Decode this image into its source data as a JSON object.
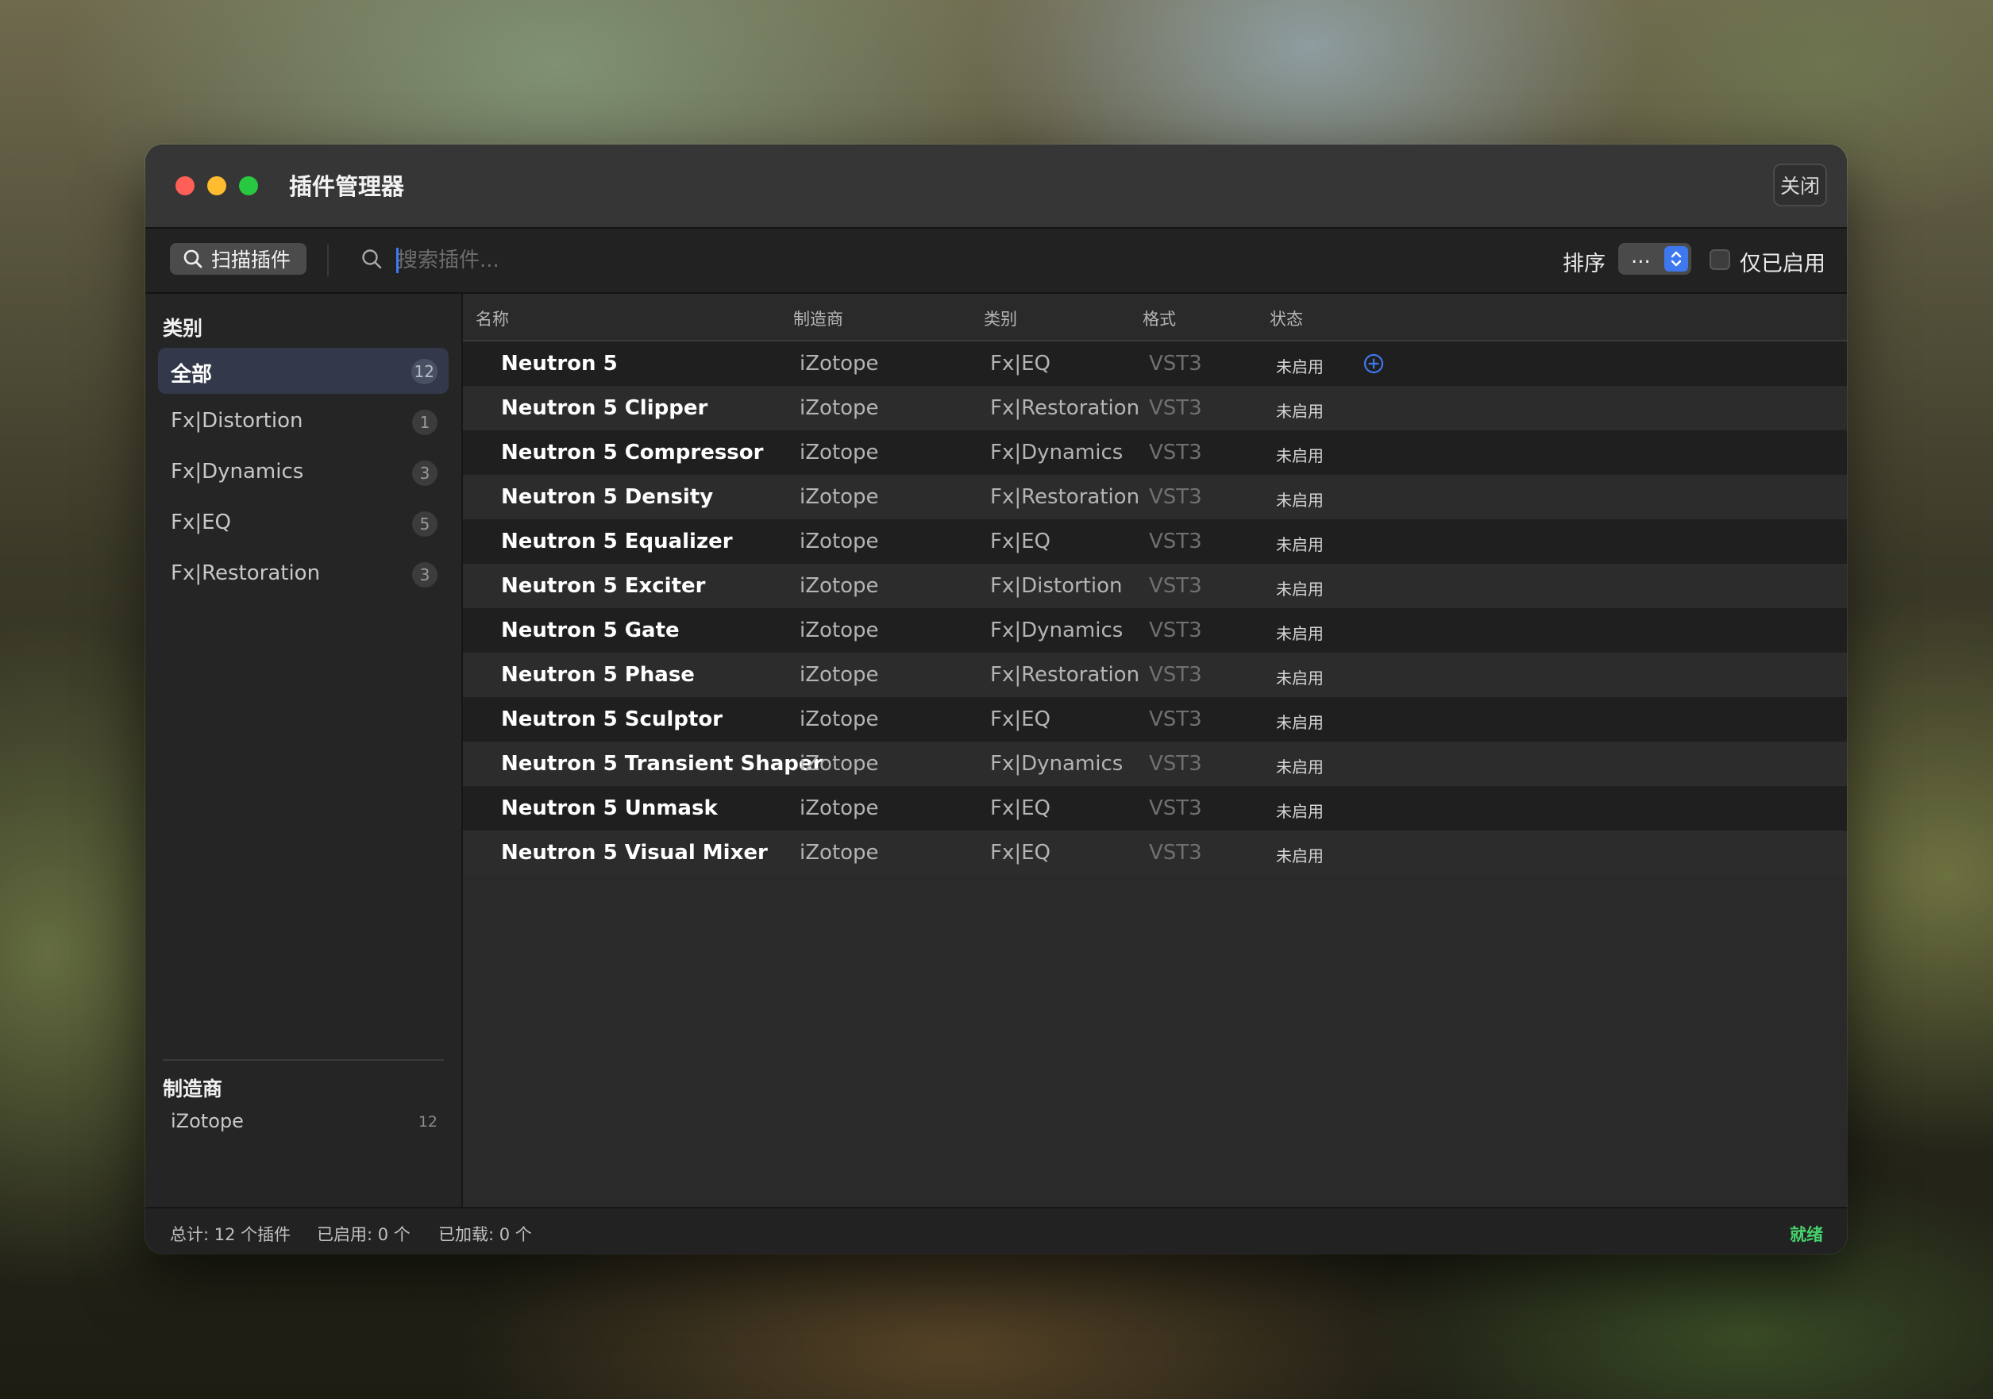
{
  "window": {
    "title": "插件管理器",
    "close_label": "关闭"
  },
  "toolbar": {
    "scan_label": "扫描插件",
    "search_placeholder": "搜索插件...",
    "sort_label": "排序",
    "sort_value": "...",
    "enabled_only_label": "仅已启用",
    "enabled_only_checked": false
  },
  "sidebar": {
    "categories_title": "类别",
    "categories": [
      {
        "label": "全部",
        "count": "12",
        "active": true
      },
      {
        "label": "Fx|Distortion",
        "count": "1",
        "active": false
      },
      {
        "label": "Fx|Dynamics",
        "count": "3",
        "active": false
      },
      {
        "label": "Fx|EQ",
        "count": "5",
        "active": false
      },
      {
        "label": "Fx|Restoration",
        "count": "3",
        "active": false
      }
    ],
    "manufacturers_title": "制造商",
    "manufacturers": [
      {
        "label": "iZotope",
        "count": "12"
      }
    ]
  },
  "table": {
    "headers": {
      "name": "名称",
      "manufacturer": "制造商",
      "category": "类别",
      "format": "格式",
      "status": "状态"
    },
    "rows": [
      {
        "name": "Neutron 5",
        "manufacturer": "iZotope",
        "category": "Fx|EQ",
        "format": "VST3",
        "status": "未启用"
      },
      {
        "name": "Neutron 5 Clipper",
        "manufacturer": "iZotope",
        "category": "Fx|Restoration",
        "format": "VST3",
        "status": "未启用"
      },
      {
        "name": "Neutron 5 Compressor",
        "manufacturer": "iZotope",
        "category": "Fx|Dynamics",
        "format": "VST3",
        "status": "未启用"
      },
      {
        "name": "Neutron 5 Density",
        "manufacturer": "iZotope",
        "category": "Fx|Restoration",
        "format": "VST3",
        "status": "未启用"
      },
      {
        "name": "Neutron 5 Equalizer",
        "manufacturer": "iZotope",
        "category": "Fx|EQ",
        "format": "VST3",
        "status": "未启用"
      },
      {
        "name": "Neutron 5 Exciter",
        "manufacturer": "iZotope",
        "category": "Fx|Distortion",
        "format": "VST3",
        "status": "未启用"
      },
      {
        "name": "Neutron 5 Gate",
        "manufacturer": "iZotope",
        "category": "Fx|Dynamics",
        "format": "VST3",
        "status": "未启用"
      },
      {
        "name": "Neutron 5 Phase",
        "manufacturer": "iZotope",
        "category": "Fx|Restoration",
        "format": "VST3",
        "status": "未启用"
      },
      {
        "name": "Neutron 5 Sculptor",
        "manufacturer": "iZotope",
        "category": "Fx|EQ",
        "format": "VST3",
        "status": "未启用"
      },
      {
        "name": "Neutron 5 Transient Shaper",
        "manufacturer": "iZotope",
        "category": "Fx|Dynamics",
        "format": "VST3",
        "status": "未启用"
      },
      {
        "name": "Neutron 5 Unmask",
        "manufacturer": "iZotope",
        "category": "Fx|EQ",
        "format": "VST3",
        "status": "未启用"
      },
      {
        "name": "Neutron 5 Visual Mixer",
        "manufacturer": "iZotope",
        "category": "Fx|EQ",
        "format": "VST3",
        "status": "未启用"
      }
    ],
    "row_action_icon": "plus-circle-icon"
  },
  "statusbar": {
    "total": "总计: 12 个插件",
    "enabled": "已启用: 0 个",
    "loaded": "已加载: 0 个",
    "state": "就绪"
  },
  "colors": {
    "accent": "#3d78ef",
    "ready": "#46d36b",
    "active_category_bg": "#33394a"
  },
  "icons": {
    "search": "search-icon",
    "sort_chevron": "chevron-up-down-icon"
  }
}
